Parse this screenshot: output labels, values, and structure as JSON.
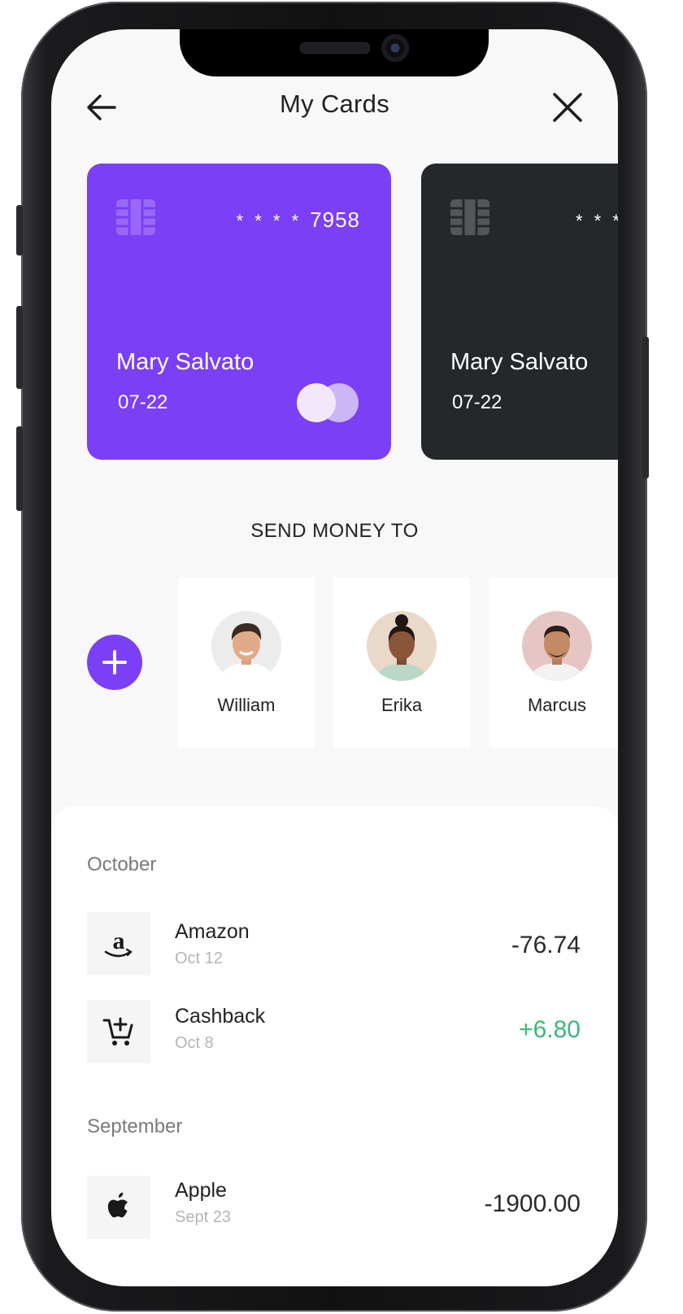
{
  "header": {
    "title": "My Cards"
  },
  "cards": [
    {
      "masked": "* * * *",
      "last4": "7958",
      "holder": "Mary Salvato",
      "expiry": "07-22",
      "color": "#7b3ff5"
    },
    {
      "masked": "* * *",
      "last4": "",
      "holder": "Mary Salvato",
      "expiry": "07-22",
      "color": "#24282a"
    }
  ],
  "send": {
    "title": "SEND MONEY TO",
    "contacts": [
      {
        "name": "William"
      },
      {
        "name": "Erika"
      },
      {
        "name": "Marcus"
      }
    ]
  },
  "transactions": {
    "groups": [
      {
        "month": "October",
        "items": [
          {
            "name": "Amazon",
            "date": "Oct 12",
            "amount": "-76.74",
            "icon": "amazon-logo"
          },
          {
            "name": "Cashback",
            "date": "Oct 8",
            "amount": "+6.80",
            "icon": "cart-add-icon"
          }
        ]
      },
      {
        "month": "September",
        "items": [
          {
            "name": "Apple",
            "date": "Sept 23",
            "amount": "-1900.00",
            "icon": "apple-logo"
          }
        ]
      }
    ]
  },
  "colors": {
    "accent": "#7b3ff5",
    "positive": "#3bb87a",
    "dark_card": "#24282a"
  }
}
